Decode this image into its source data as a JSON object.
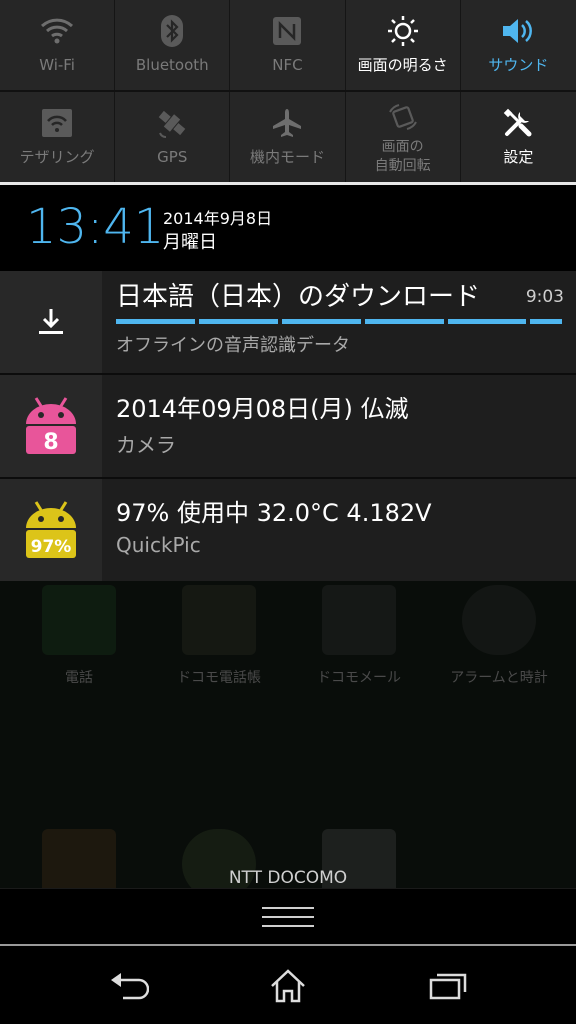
{
  "quick_settings": {
    "row1": [
      {
        "label": "Wi-Fi",
        "icon": "wifi-icon",
        "state": "off"
      },
      {
        "label": "Bluetooth",
        "icon": "bluetooth-icon",
        "state": "off"
      },
      {
        "label": "NFC",
        "icon": "nfc-icon",
        "state": "off"
      },
      {
        "label": "画面の明るさ",
        "icon": "brightness-icon",
        "state": "on"
      },
      {
        "label": "サウンド",
        "icon": "sound-icon",
        "state": "active"
      }
    ],
    "row2": [
      {
        "label": "テザリング",
        "icon": "tethering-icon",
        "state": "off"
      },
      {
        "label": "GPS",
        "icon": "gps-icon",
        "state": "off"
      },
      {
        "label": "機内モード",
        "icon": "airplane-icon",
        "state": "off"
      },
      {
        "label_line1": "画面の",
        "label_line2": "自動回転",
        "icon": "auto-rotate-icon",
        "state": "off"
      },
      {
        "label": "設定",
        "icon": "settings-tools-icon",
        "state": "on"
      }
    ]
  },
  "clock": {
    "time": "13:41",
    "date": "2014年9月8日",
    "weekday": "月曜日"
  },
  "notifications": [
    {
      "icon": "download-icon",
      "title": "日本語（日本）のダウンロード",
      "time": "9:03",
      "subtitle": "オフラインの音声認識データ",
      "progress_segments": 6
    },
    {
      "icon": "android-calendar-icon",
      "icon_text": "8",
      "title": "2014年09月08日(月) 仏滅",
      "subtitle": "カメラ"
    },
    {
      "icon": "android-battery-icon",
      "icon_text": "97%",
      "title": "97%  使用中  32.0°C  4.182V",
      "subtitle": "QuickPic"
    }
  ],
  "home": {
    "app_labels": [
      "電話",
      "ドコモ電話帳",
      "ドコモメール",
      "アラームと時計"
    ],
    "carrier": "NTT DOCOMO"
  },
  "colors": {
    "accent": "#4fb6ef",
    "pink": "#e8559a",
    "yellow": "#dcc419"
  },
  "nav": [
    "back-icon",
    "home-icon",
    "recents-icon"
  ]
}
